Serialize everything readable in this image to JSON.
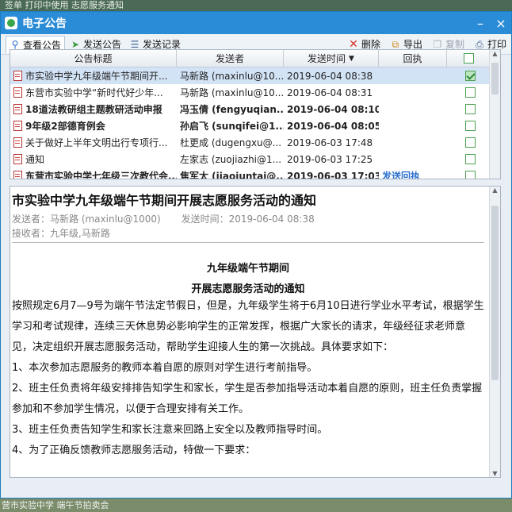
{
  "desktop": {
    "top_text": "签单    打印中使用    志愿服务通知",
    "bottom_text": "营市实验中学 端午节拍卖会"
  },
  "window": {
    "title": "电子公告",
    "minimize_label": "–",
    "close_label": "×"
  },
  "toolbar": {
    "tabs": [
      {
        "label": "查看公告",
        "icon": "magnifier-icon"
      },
      {
        "label": "发送公告",
        "icon": "send-arrow-icon"
      },
      {
        "label": "发送记录",
        "icon": "list-icon"
      }
    ],
    "actions": [
      {
        "label": "删除",
        "icon": "delete-x-icon",
        "enabled": true
      },
      {
        "label": "导出",
        "icon": "export-icon",
        "enabled": true
      },
      {
        "label": "复制",
        "icon": "copy-icon",
        "enabled": false
      },
      {
        "label": "打印",
        "icon": "printer-icon",
        "enabled": true
      }
    ]
  },
  "list": {
    "columns": [
      "公告标题",
      "发送者",
      "发送时间",
      "回执"
    ],
    "rows": [
      {
        "title": "市实验中学九年级端午节期间开...",
        "sender": "马新路 (maxinlu@10...",
        "time": "2019-06-04 08:38",
        "receipt": "",
        "checked": true,
        "bold": false,
        "selected": true
      },
      {
        "title": "东营市实验中学“新时代好少年...",
        "sender": "马新路 (maxinlu@10...",
        "time": "2019-06-04 08:31",
        "receipt": "",
        "checked": false,
        "bold": false,
        "selected": false
      },
      {
        "title": "18道法教研组主题教研活动申报",
        "sender": "冯玉倩 (fengyuqian...",
        "time": "2019-06-04 08:10",
        "receipt": "",
        "checked": false,
        "bold": true,
        "selected": false
      },
      {
        "title": "9年级2部德育例会",
        "sender": "孙启飞 (sunqifei@1...",
        "time": "2019-06-04 08:05",
        "receipt": "",
        "checked": false,
        "bold": true,
        "selected": false
      },
      {
        "title": "关于做好上半年文明出行专项行...",
        "sender": "杜更成 (dugengxu@...",
        "time": "2019-06-03 17:48",
        "receipt": "",
        "checked": false,
        "bold": false,
        "selected": false
      },
      {
        "title": "通知",
        "sender": "左家志 (zuojiazhi@1...",
        "time": "2019-06-03 17:25",
        "receipt": "",
        "checked": false,
        "bold": false,
        "selected": false
      },
      {
        "title": "东营市实验中学七年级三次教代会...",
        "sender": "焦军太 (jiaojuntai@...",
        "time": "2019-06-03 17:03",
        "receipt": "发送回执",
        "checked": false,
        "bold": true,
        "selected": false
      }
    ]
  },
  "detail": {
    "title": "市实验中学九年级端午节期间开展志愿服务活动的通知",
    "sender": "发送者：马新路 (maxinlu@1000)",
    "send_time": "发送时间：2019-06-04 08:38",
    "recipients": "接收者：九年级,马新路",
    "heading1": "九年级端午节期间",
    "heading2": "开展志愿服务活动的通知",
    "paragraphs": [
      "        按照规定6月7—9号为端午节法定节假日，但是，九年级学生将于6月10日进行学业水平考试，根据学生学习和考试规律，连续三天休息势必影响学生的正常发挥，根据广大家长的请求，年级经征求老师意见，决定组织开展志愿服务活动，帮助学生迎接人生的第一次挑战。具体要求如下：",
      "1、本次参加志愿服务的教师本着自愿的原则对学生进行考前指导。",
      "2、班主任负责将年级安排排告知学生和家长，学生是否参加指导活动本着自愿的原则，班主任负责掌握参加和不参加学生情况，以便于合理安排有关工作。",
      "3、班主任负责告知学生和家长注意来回路上安全以及教师指导时间。",
      "4、为了正确反馈教师志愿服务活动，特做一下要求："
    ]
  }
}
